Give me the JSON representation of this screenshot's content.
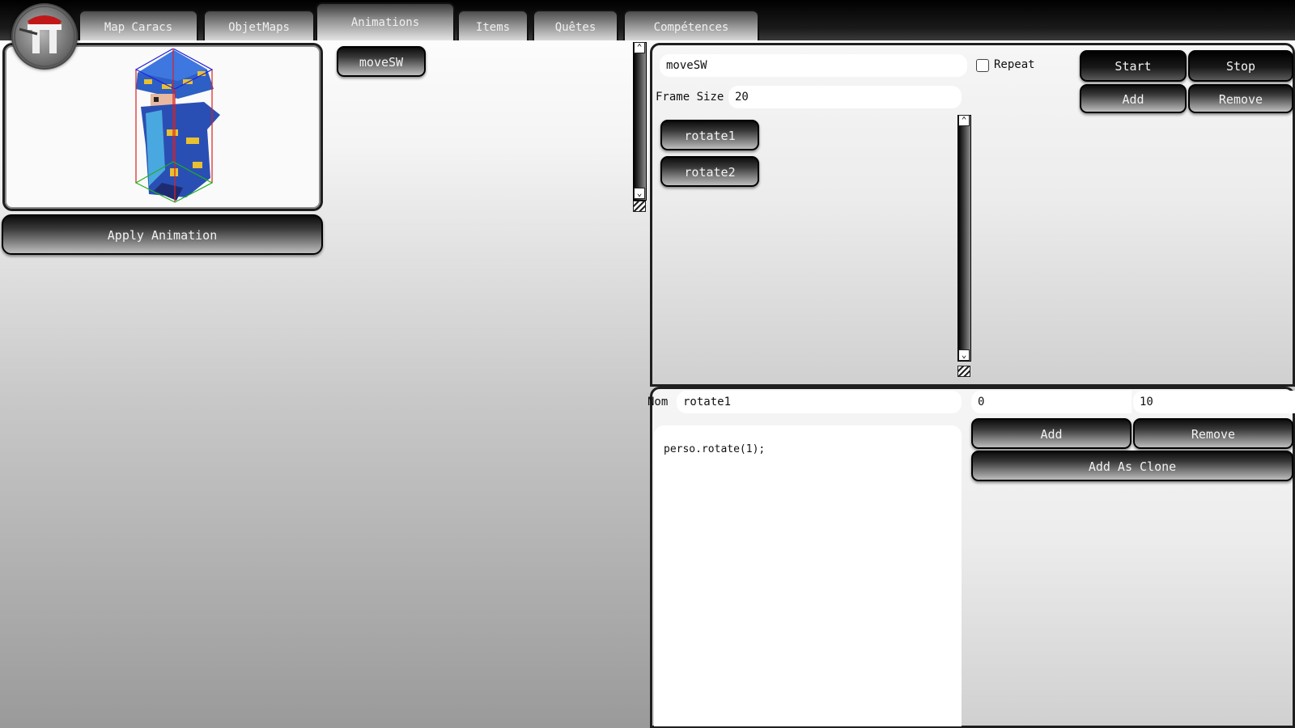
{
  "tabs": [
    {
      "label": "Map Caracs"
    },
    {
      "label": "ObjetMaps"
    },
    {
      "label": "Animations"
    },
    {
      "label": "Items"
    },
    {
      "label": "Quêtes"
    },
    {
      "label": "Compétences"
    }
  ],
  "left": {
    "apply_button": "Apply Animation"
  },
  "animations_list": {
    "items": [
      {
        "label": "moveSW"
      }
    ]
  },
  "animation_editor": {
    "name_value": "moveSW",
    "repeat_label": "Repeat",
    "repeat_checked": false,
    "frame_size_label": "Frame Size",
    "frame_size_value": "20",
    "start_button": "Start",
    "stop_button": "Stop",
    "add_button": "Add",
    "remove_button": "Remove",
    "frames": [
      {
        "label": "rotate1"
      },
      {
        "label": "rotate2"
      }
    ]
  },
  "frame_editor": {
    "name_label": "Nom",
    "name_value": "rotate1",
    "value_a": "0",
    "value_b": "10",
    "code": "perso.rotate(1);",
    "add_button": "Add",
    "remove_button": "Remove",
    "add_clone_button": "Add As Clone"
  },
  "icons": {
    "logo": "crest-logo-icon",
    "scroll_up": "chevron-up-icon",
    "scroll_down": "chevron-down-icon",
    "resize": "resize-grip-icon"
  },
  "colors": {
    "bounding_top": "#1f1fdd",
    "bounding_side": "#dd1f1f",
    "bounding_bottom": "#1fb01f"
  }
}
